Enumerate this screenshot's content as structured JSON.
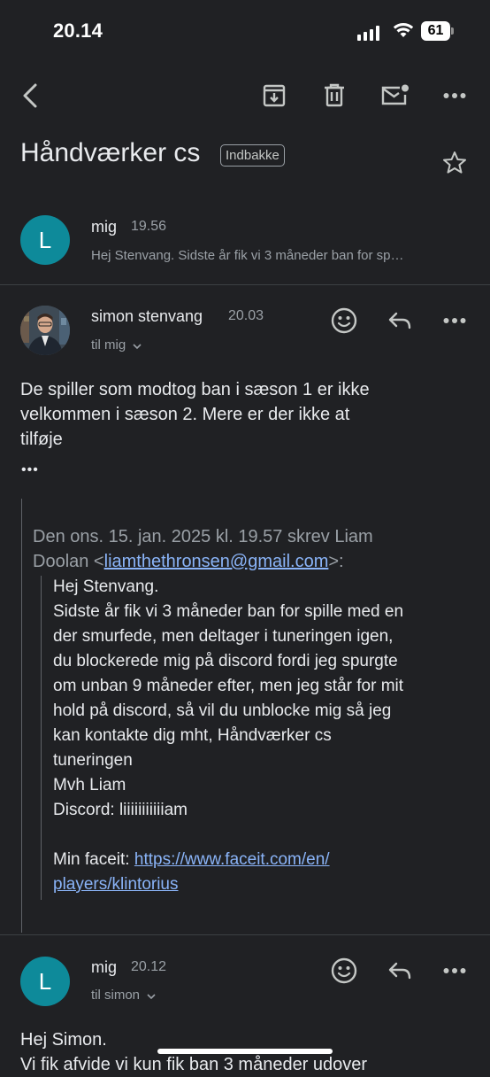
{
  "status": {
    "time": "20.14",
    "battery": "61"
  },
  "toolbar": {
    "icons": [
      "back-icon",
      "archive-icon",
      "trash-icon",
      "mark-unread-icon",
      "more-icon"
    ]
  },
  "thread": {
    "subject": "Håndværker cs",
    "label": "Indbakke"
  },
  "collapsed_message": {
    "avatar_letter": "L",
    "sender": "mig",
    "time": "19.56",
    "snippet": "Hej Stenvang. Sidste år fik vi 3 måneder ban for sp…"
  },
  "message": {
    "sender": "simon stenvang",
    "time": "20.03",
    "to": "til mig",
    "body_lines": [
      "De spiller som modtog ban i sæson 1 er ikke",
      "velkommen i sæson 2. Mere er der ikke at",
      "tilføje"
    ],
    "ellipsis": "•••",
    "quote": {
      "header_line1": "Den ons. 15. jan. 2025 kl. 19.57 skrev Liam",
      "header_prefix": "Doolan <",
      "header_email": "liamthethronsen@gmail.com",
      "header_suffix": ">:",
      "lines": [
        "Hej Stenvang.",
        "Sidste år fik vi 3 måneder ban for spille med en",
        "der smurfede, men deltager i tuneringen igen,",
        "du blockerede mig på discord fordi jeg spurgte",
        "om unban 9 måneder efter, men jeg står for mit",
        "hold på discord, så vil du unblocke mig så jeg",
        "kan kontakte dig mht, Håndværker cs",
        "tuneringen",
        "Mvh Liam",
        "Discord: liiiiiiiiiiiam"
      ],
      "faceit_label": "Min faceit: ",
      "faceit_link_line1": "https://www.faceit.com/en/",
      "faceit_link_line2": "players/klintorius"
    }
  },
  "reply_message": {
    "avatar_letter": "L",
    "sender": "mig",
    "time": "20.12",
    "to": "til simon",
    "body_line1": "Hej Simon.",
    "body_line2": "Vi fik afvide vi kun fik ban 3 måneder udover"
  }
}
